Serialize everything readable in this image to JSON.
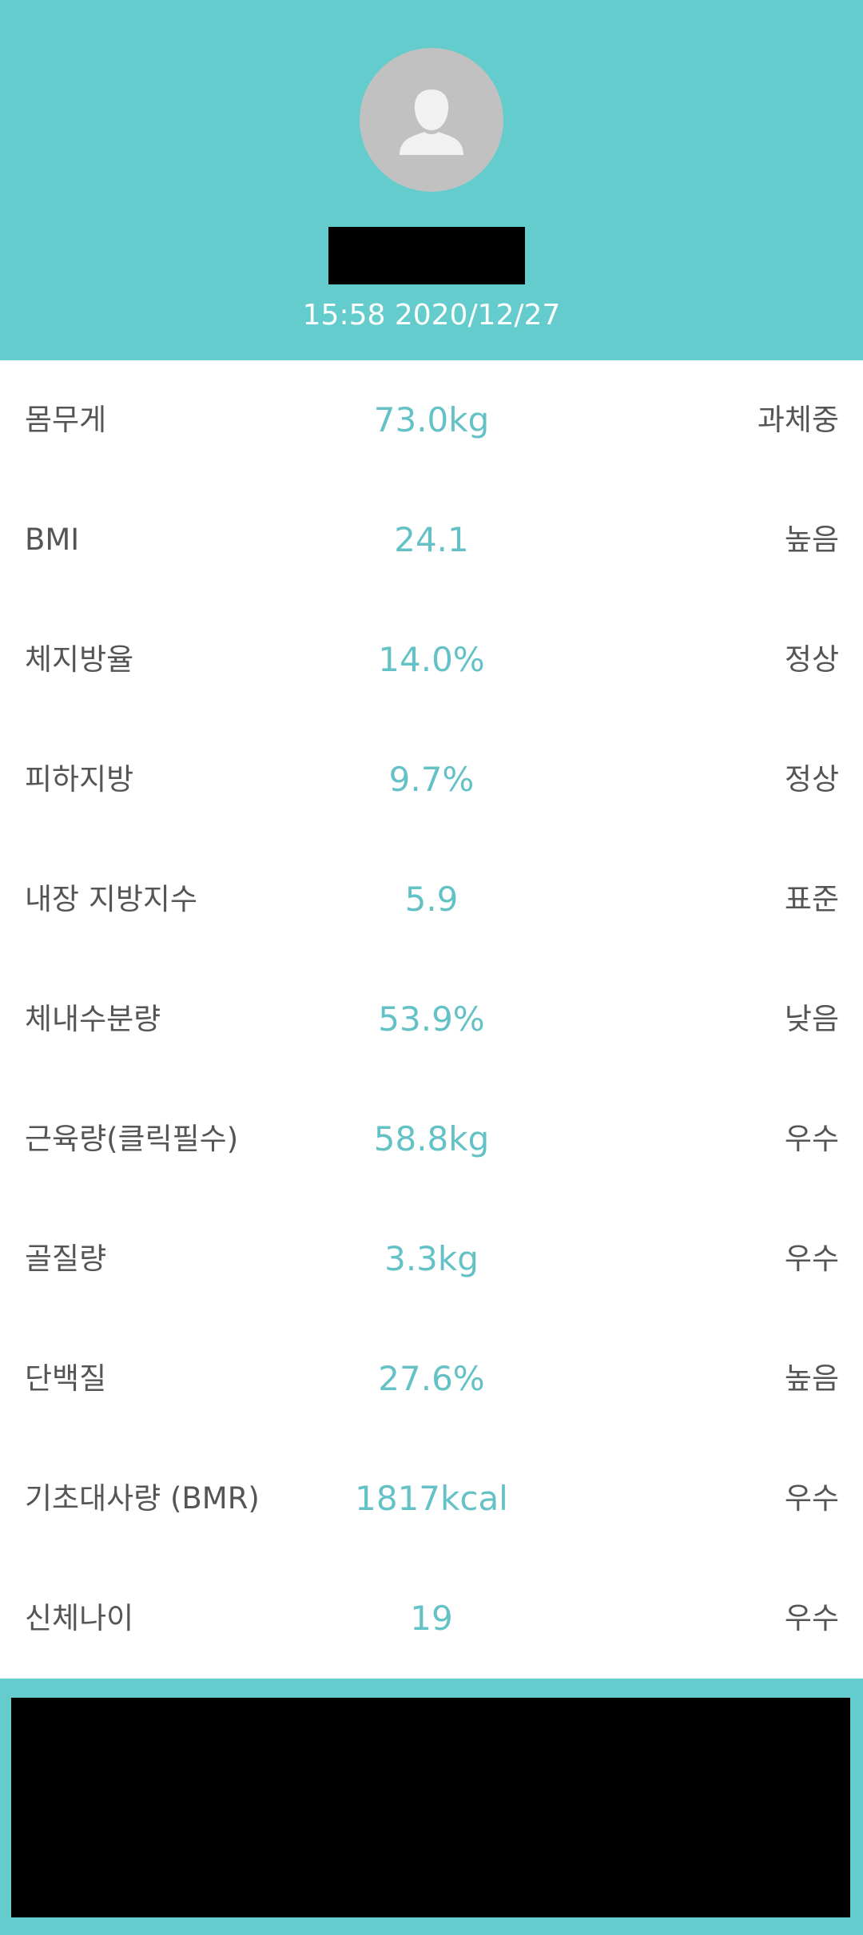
{
  "header": {
    "timestamp": "15:58 2020/12/27",
    "avatar_icon": "user-silhouette-icon"
  },
  "metrics": [
    {
      "label": "몸무게",
      "value": "73.0kg",
      "status": "과체중"
    },
    {
      "label": "BMI",
      "value": "24.1",
      "status": "높음"
    },
    {
      "label": "체지방율",
      "value": "14.0%",
      "status": "정상"
    },
    {
      "label": "피하지방",
      "value": "9.7%",
      "status": "정상"
    },
    {
      "label": "내장 지방지수",
      "value": "5.9",
      "status": "표준"
    },
    {
      "label": "체내수분량",
      "value": "53.9%",
      "status": "낮음"
    },
    {
      "label": "근육량(클릭필수)",
      "value": "58.8kg",
      "status": "우수"
    },
    {
      "label": "골질량",
      "value": "3.3kg",
      "status": "우수"
    },
    {
      "label": "단백질",
      "value": "27.6%",
      "status": "높음"
    },
    {
      "label": "기초대사량 (BMR)",
      "value": "1817kcal",
      "status": "우수"
    },
    {
      "label": "신체나이",
      "value": "19",
      "status": "우수"
    }
  ],
  "colors": {
    "accent": "#64cccd",
    "value_text": "#64c2c7",
    "label_text": "#555555"
  }
}
